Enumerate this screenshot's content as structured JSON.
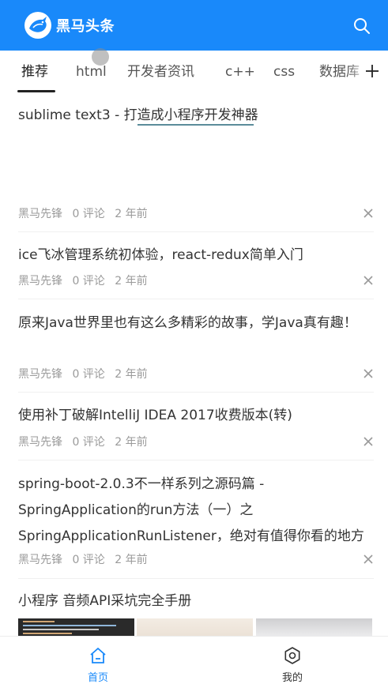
{
  "header": {
    "logo_text": "黑马头条",
    "brand_color": "#1989fa",
    "logo_icon": "horse-logo-icon",
    "search_icon": "search-icon"
  },
  "tabs": {
    "items": [
      "推荐",
      "html",
      "开发者资讯",
      "c++",
      "css",
      "数据库"
    ],
    "active_index": 0,
    "add_icon": "plus-icon"
  },
  "articles": [
    {
      "title": "sublime text3 - 打造成小程序开发神器",
      "author": "黑马先锋",
      "comments": "0 评论",
      "time": "2 年前"
    },
    {
      "title": "ice飞冰管理系统初体验，react-redux简单入门",
      "author": "黑马先锋",
      "comments": "0 评论",
      "time": "2 年前"
    },
    {
      "title": "原来Java世界里也有这么多精彩的故事，学Java真有趣！",
      "author": "黑马先锋",
      "comments": "0 评论",
      "time": "2 年前"
    },
    {
      "title": "使用补丁破解IntelliJ IDEA 2017收费版本(转)",
      "author": "黑马先锋",
      "comments": "0 评论",
      "time": "2 年前"
    },
    {
      "title": "spring-boot-2.0.3不一样系列之源码篇 - SpringApplication的run方法（一）之SpringApplicationRunListener，绝对有值得你看的地方",
      "author": "黑马先锋",
      "comments": "0 评论",
      "time": "2 年前"
    },
    {
      "title": "小程序 音频API采坑完全手册"
    }
  ],
  "tabbar": {
    "items": [
      {
        "label": "首页",
        "icon": "home-icon",
        "active": true
      },
      {
        "label": "我的",
        "icon": "gear-icon",
        "active": false
      }
    ],
    "active_color": "#1989fa",
    "inactive_color": "#333333"
  }
}
